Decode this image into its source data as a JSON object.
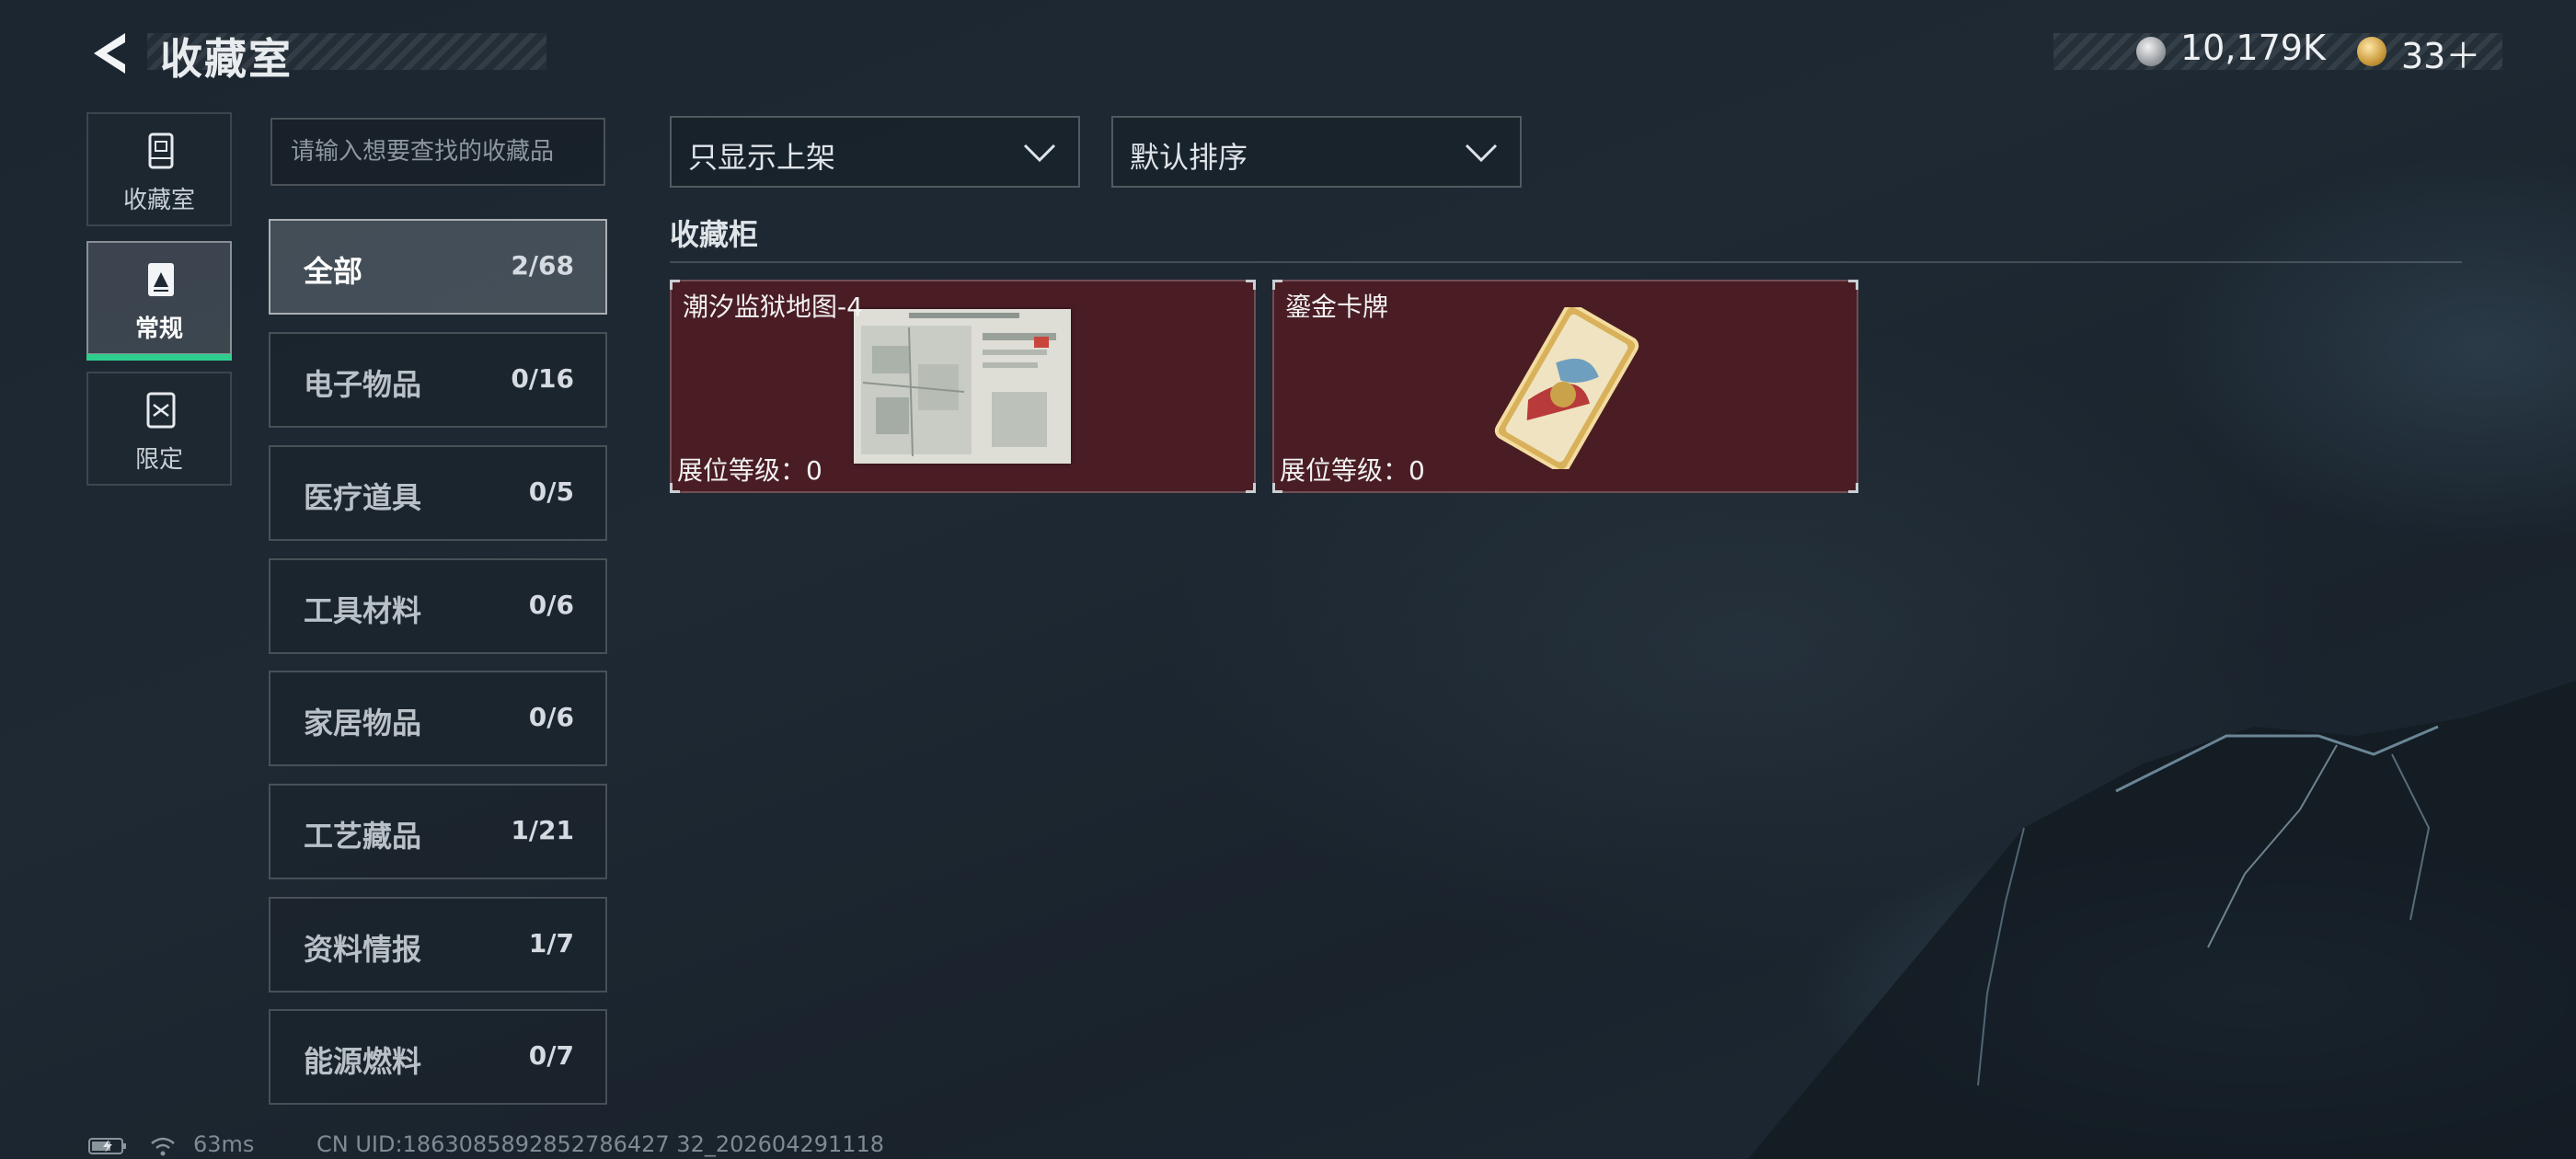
{
  "header": {
    "title": "收藏室",
    "currency": [
      {
        "icon": "silver-coin-icon",
        "value": "10,179K"
      },
      {
        "icon": "gold-coin-icon",
        "value": "33＋"
      }
    ]
  },
  "nav": [
    {
      "label": "收藏室",
      "icon": "trophy-cabinet-icon",
      "active": false
    },
    {
      "label": "常规",
      "icon": "card-icon",
      "active": true
    },
    {
      "label": "限定",
      "icon": "shuffle-card-icon",
      "active": false
    }
  ],
  "search": {
    "placeholder": "请输入想要查找的收藏品"
  },
  "categories": [
    {
      "name": "全部",
      "count": "2/68",
      "active": true
    },
    {
      "name": "电子物品",
      "count": "0/16"
    },
    {
      "name": "医疗道具",
      "count": "0/5"
    },
    {
      "name": "工具材料",
      "count": "0/6"
    },
    {
      "name": "家居物品",
      "count": "0/6"
    },
    {
      "name": "工艺藏品",
      "count": "1/21"
    },
    {
      "name": "资料情报",
      "count": "1/7"
    },
    {
      "name": "能源燃料",
      "count": "0/7"
    }
  ],
  "filters": {
    "display": "只显示上架",
    "sort": "默认排序"
  },
  "section": {
    "title": "收藏柜"
  },
  "items": [
    {
      "name": "潮汐监狱地图-4",
      "level": "展位等级：0",
      "card_color": "#4a1d24"
    },
    {
      "name": "鎏金卡牌",
      "level": "展位等级：0",
      "card_color": "#4a1d24"
    }
  ],
  "footer": {
    "ping": "63ms",
    "uid": "CN UID:1863085892852786427 32_202604291118"
  },
  "colors": {
    "accent": "#2ecf8e",
    "card_bg": "#4a1d24"
  }
}
